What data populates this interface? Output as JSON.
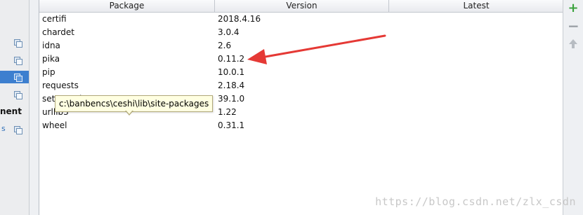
{
  "left_pane": {
    "section_text": "nent",
    "partial_label": "s"
  },
  "table": {
    "columns": [
      "Package",
      "Version",
      "Latest"
    ],
    "rows": [
      {
        "package": "certifi",
        "version": "2018.4.16",
        "latest": ""
      },
      {
        "package": "chardet",
        "version": "3.0.4",
        "latest": ""
      },
      {
        "package": "idna",
        "version": "2.6",
        "latest": ""
      },
      {
        "package": "pika",
        "version": "0.11.2",
        "latest": ""
      },
      {
        "package": "pip",
        "version": "10.0.1",
        "latest": ""
      },
      {
        "package": "requests",
        "version": "2.18.4",
        "latest": ""
      },
      {
        "package": "setuptools",
        "version": "39.1.0",
        "latest": ""
      },
      {
        "package": "urllib3",
        "version": "1.22",
        "latest": ""
      },
      {
        "package": "wheel",
        "version": "0.31.1",
        "latest": ""
      }
    ]
  },
  "tooltip": {
    "text": "c:\\banbencs\\ceshi\\lib\\site-packages"
  },
  "toolbar": {
    "install_icon": "plus-icon",
    "uninstall_icon": "minus-icon",
    "upgrade_icon": "up-arrow-icon"
  },
  "annotation": {
    "arrow_color": "#e53935"
  },
  "watermark": {
    "text": "https://blog.csdn.net/zlx_csdn"
  }
}
